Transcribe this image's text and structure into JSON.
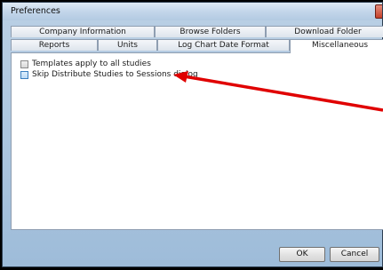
{
  "window": {
    "title": "Preferences"
  },
  "tabs": {
    "row1": [
      {
        "label": "Company Information"
      },
      {
        "label": "Browse Folders"
      },
      {
        "label": "Download Folder"
      }
    ],
    "row2": [
      {
        "label": "Reports"
      },
      {
        "label": "Units"
      },
      {
        "label": "Log Chart Date Format"
      },
      {
        "label": "Miscellaneous",
        "active": true
      }
    ]
  },
  "options": [
    {
      "label": "Templates apply to all studies",
      "checked": false
    },
    {
      "label": "Skip Distribute Studies to Sessions dialog",
      "checked": false
    }
  ],
  "buttons": {
    "ok": "OK",
    "cancel": "Cancel"
  },
  "colors": {
    "annotation_arrow": "#e00000"
  }
}
